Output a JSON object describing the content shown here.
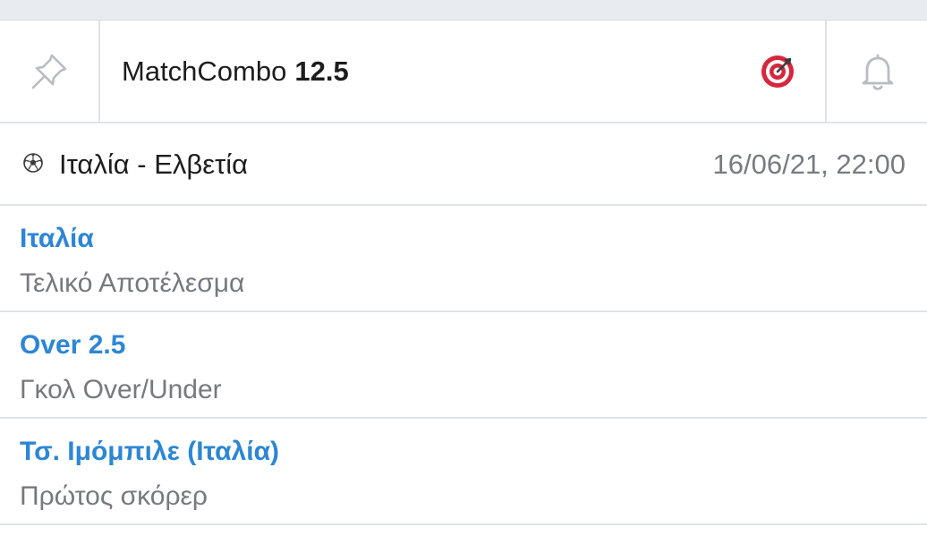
{
  "header": {
    "title": "MatchCombo",
    "odds": "12.5",
    "accent_color": "#d6263d",
    "pin_icon": "pin-icon",
    "target_icon": "target-icon",
    "bell_icon": "bell-icon"
  },
  "match": {
    "sport_icon": "soccer-ball-icon",
    "name": "Ιταλία - Ελβετία",
    "datetime": "16/06/21, 22:00"
  },
  "selections": [
    {
      "pick": "Ιταλία",
      "market": "Τελικό Αποτέλεσμα"
    },
    {
      "pick": "Over 2.5",
      "market": "Γκολ Over/Under"
    },
    {
      "pick": "Τσ. Ιμόμπιλε (Ιταλία)",
      "market": "Πρώτος σκόρερ"
    }
  ],
  "colors": {
    "link_blue": "#2d86d4",
    "muted_text": "#76797e",
    "divider": "#e0e3e7",
    "background": "#e8ebef"
  }
}
